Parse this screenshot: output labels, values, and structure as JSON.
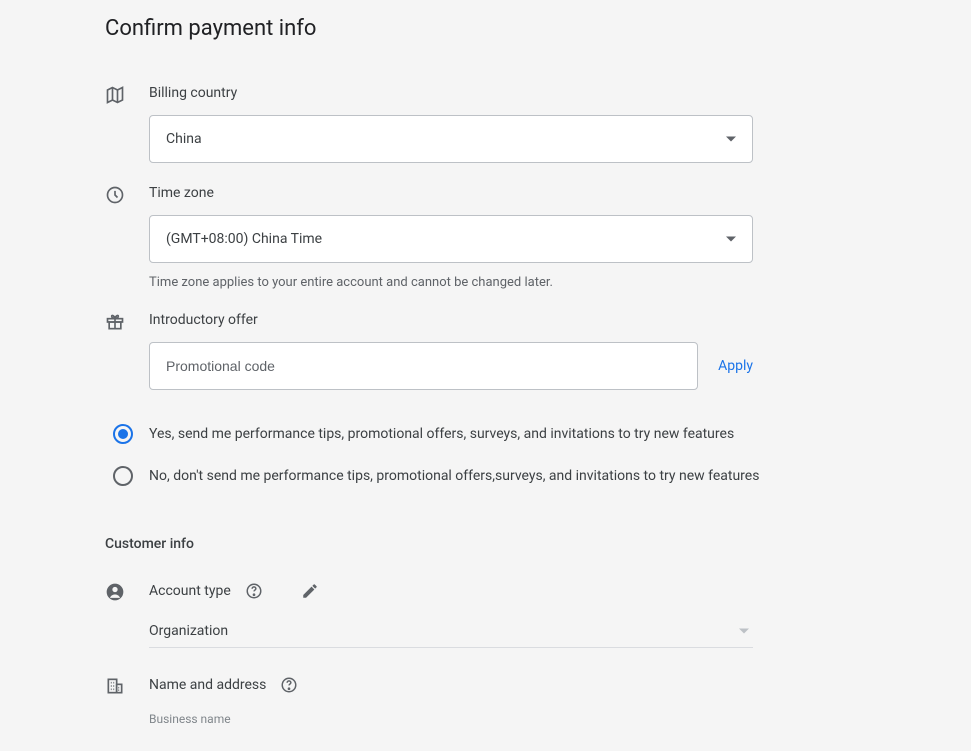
{
  "title": "Confirm payment info",
  "billing_country": {
    "label": "Billing country",
    "value": "China"
  },
  "time_zone": {
    "label": "Time zone",
    "value": "(GMT+08:00) China Time",
    "helper": "Time zone applies to your entire account and cannot be changed later."
  },
  "intro_offer": {
    "label": "Introductory offer",
    "placeholder": "Promotional code",
    "apply": "Apply"
  },
  "radios": {
    "yes": "Yes, send me performance tips, promotional offers, surveys, and invitations to try new features",
    "no": "No, don't send me performance tips, promotional offers,surveys, and invitations to try new features"
  },
  "customer_info": {
    "title": "Customer info",
    "account_type_label": "Account type",
    "account_type_value": "Organization",
    "name_address_label": "Name and address",
    "business_name_label": "Business name"
  }
}
